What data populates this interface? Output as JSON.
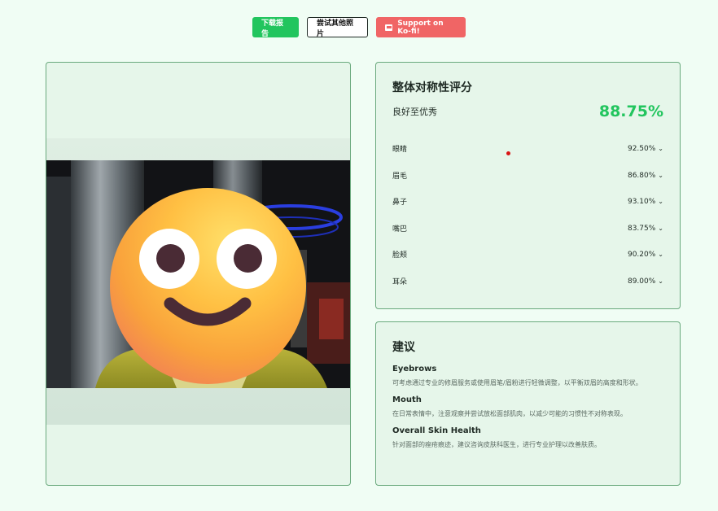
{
  "toolbar": {
    "download_label": "下载报告",
    "try_other_label": "尝试其他照片",
    "kofi_label": "Support on Ko-fi!"
  },
  "colors": {
    "accent": "#22c55e",
    "kofi": "#f06565",
    "card_border": "#6aa97d"
  },
  "symmetry": {
    "title": "整体对称性评分",
    "grade": "良好至优秀",
    "overall": "88.75%",
    "metrics": [
      {
        "label": "眼睛",
        "value": "92.50%"
      },
      {
        "label": "眉毛",
        "value": "86.80%"
      },
      {
        "label": "鼻子",
        "value": "93.10%"
      },
      {
        "label": "嘴巴",
        "value": "83.75%"
      },
      {
        "label": "脸颊",
        "value": "90.20%"
      },
      {
        "label": "耳朵",
        "value": "89.00%"
      }
    ]
  },
  "suggestions": {
    "title": "建议",
    "items": [
      {
        "heading": "Eyebrows",
        "text": "可考虑通过专业的修眉服务或使用眉笔/眉粉进行轻微调整，以平衡双眉的高度和形状。"
      },
      {
        "heading": "Mouth",
        "text": "在日常表情中，注意观察并尝试放松面部肌肉，以减少可能的习惯性不对称表现。"
      },
      {
        "heading": "Overall Skin Health",
        "text": "针对面部的痤疮痕迹，建议咨询皮肤科医生，进行专业护理以改善肤质。"
      }
    ]
  }
}
